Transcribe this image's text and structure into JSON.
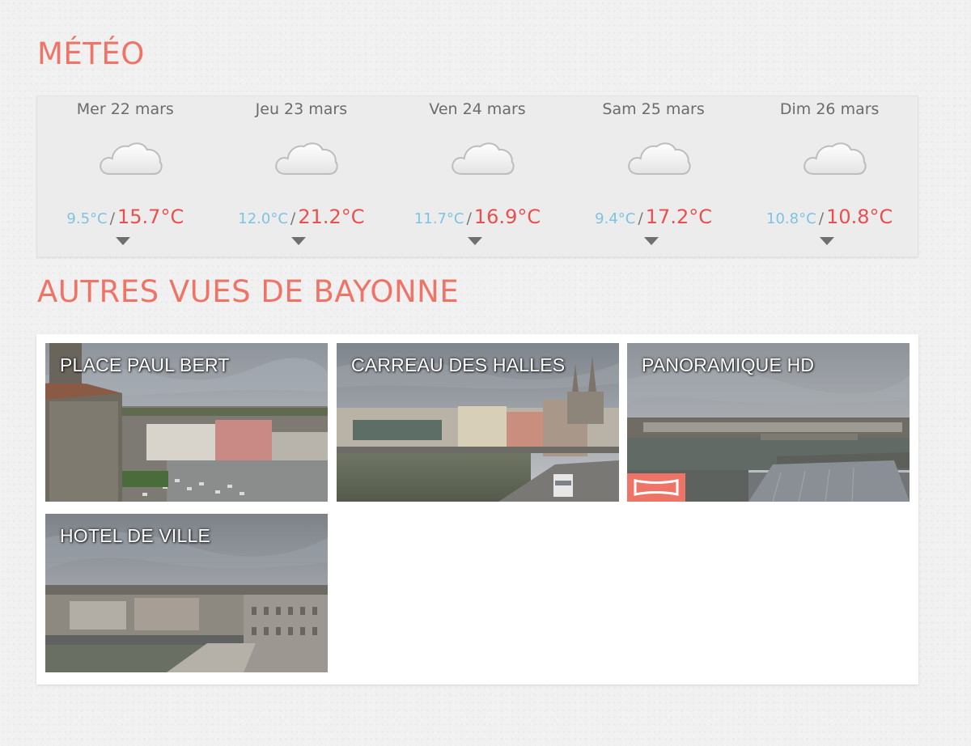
{
  "meteo": {
    "title": "MÉTÉO",
    "days": [
      {
        "name": "Mer 22 mars",
        "min": "9.5°C",
        "max": "15.7°C",
        "icon": "cloud-icon"
      },
      {
        "name": "Jeu 23 mars",
        "min": "12.0°C",
        "max": "21.2°C",
        "icon": "cloud-icon"
      },
      {
        "name": "Ven 24 mars",
        "min": "11.7°C",
        "max": "16.9°C",
        "icon": "cloud-icon"
      },
      {
        "name": "Sam 25 mars",
        "min": "9.4°C",
        "max": "17.2°C",
        "icon": "cloud-icon"
      },
      {
        "name": "Dim 26 mars",
        "min": "10.8°C",
        "max": "10.8°C",
        "icon": "cloud-icon"
      }
    ],
    "separator": "/"
  },
  "vues": {
    "title": "AUTRES VUES DE BAYONNE",
    "items": [
      {
        "label": "PLACE PAUL BERT"
      },
      {
        "label": "CARREAU DES HALLES"
      },
      {
        "label": "PANORAMIQUE HD",
        "badge_icon": "panorama-icon"
      },
      {
        "label": "HOTEL DE VILLE"
      }
    ]
  },
  "colors": {
    "accent": "#ef7468",
    "temp_min": "#7ec3e3",
    "temp_max": "#ea4f50"
  }
}
